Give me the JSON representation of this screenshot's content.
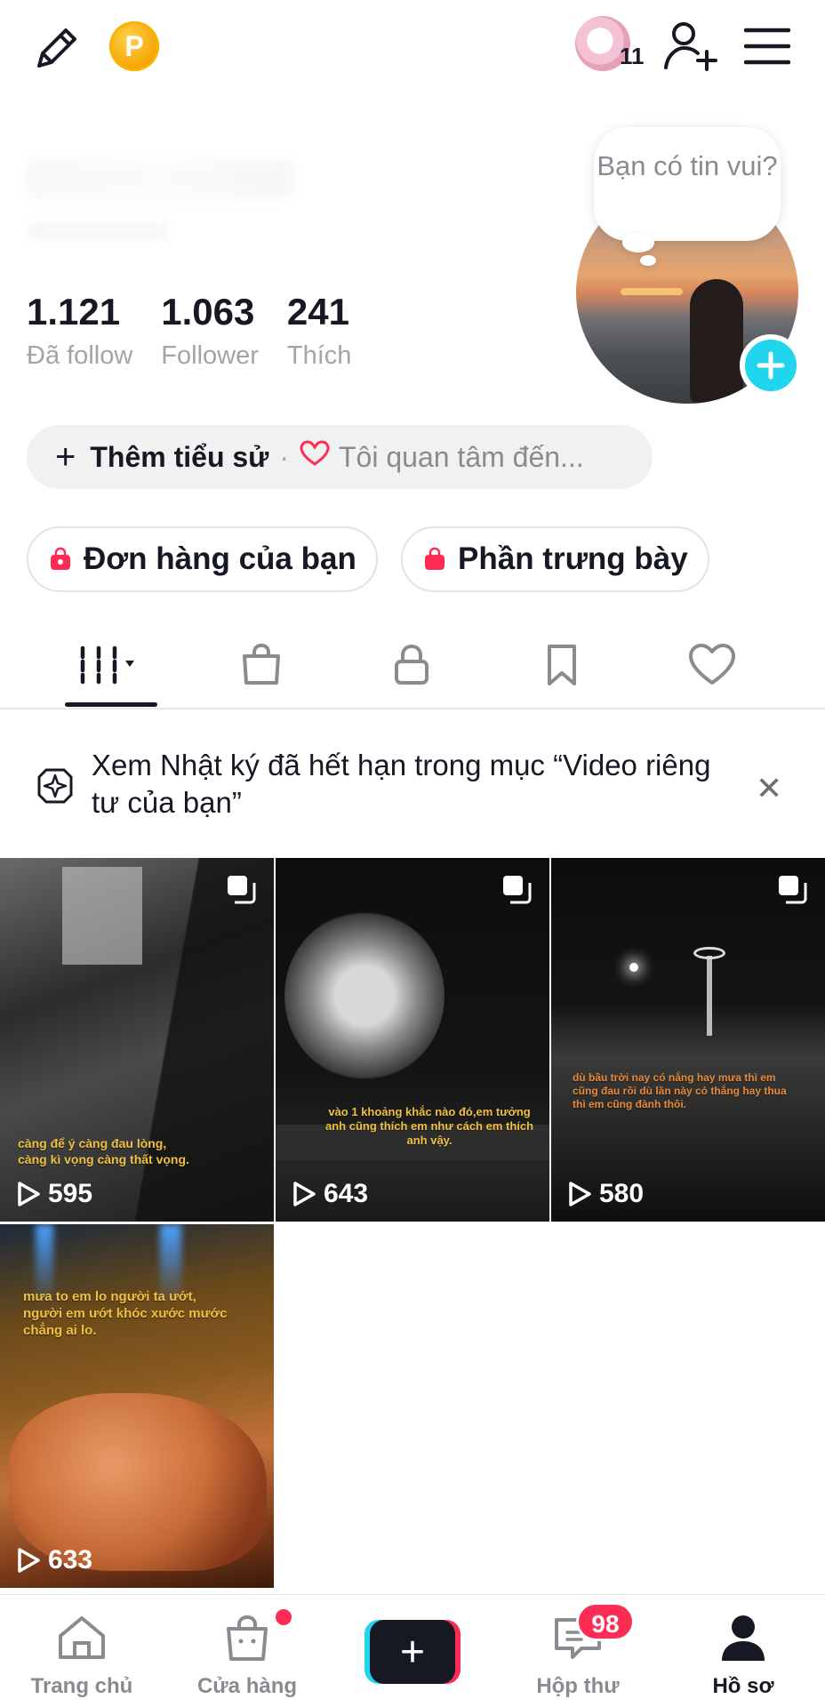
{
  "header": {
    "coin_letter": "P",
    "friends_count": "11"
  },
  "profile": {
    "stats": [
      {
        "value": "1.121",
        "label": "Đã follow"
      },
      {
        "value": "1.063",
        "label": "Follower"
      },
      {
        "value": "241",
        "label": "Thích"
      }
    ],
    "bubble_text": "Bạn có tin vui?",
    "bio": {
      "add_label": "Thêm tiểu sử",
      "separator": "·",
      "interest_placeholder": "Tôi quan tâm đến..."
    },
    "chips": [
      "Đơn hàng của bạn",
      "Phần trưng bày"
    ]
  },
  "tabs": [
    "videos-grid",
    "shop-bag",
    "private-lock",
    "favorites-bookmark",
    "liked-heart"
  ],
  "notice": {
    "text": "Xem Nhật ký đã hết hạn trong mục “Video riêng tư của bạn”",
    "close": "✕"
  },
  "videos": [
    {
      "views": "595",
      "caption": "càng để ý càng đau lòng,\ncàng kì vọng càng thất vọng."
    },
    {
      "views": "643",
      "caption": "vào 1 khoảng khắc nào đó,em tưởng\nanh cũng thích em như cách em thích\nanh vậy."
    },
    {
      "views": "580",
      "caption": "dù bầu trời nay có nắng hay mưa thì em\ncũng đau rồi dù lần này có thắng hay thua\nthì em cũng đành thôi."
    },
    {
      "views": "633",
      "caption": "mưa to em lo người ta ướt,\nngười em ướt khóc xước mước\nchẳng ai lo."
    }
  ],
  "bottom_nav": {
    "home": "Trang chủ",
    "shop": "Cửa hàng",
    "create": "+",
    "inbox": "Hộp thư",
    "inbox_badge": "98",
    "profile": "Hồ sơ"
  },
  "colors": {
    "accent_cyan": "#20d5ec",
    "accent_red": "#fe2c55",
    "text": "#161823",
    "muted": "#a3a4a8"
  }
}
